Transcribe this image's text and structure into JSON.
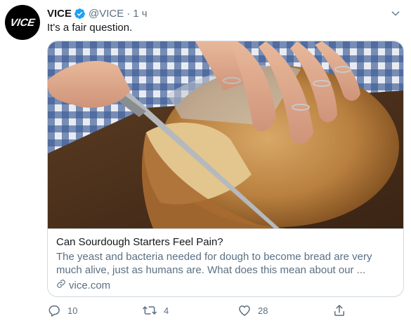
{
  "tweet": {
    "author": {
      "name": "VICE",
      "handle": "@VICE",
      "verified": true,
      "avatar_text": "VICE"
    },
    "separator": "·",
    "time": "1 ч",
    "text": "It's a fair question."
  },
  "card": {
    "image_icon": "sourdough-bread-photo",
    "title": "Can Sourdough Starters Feel Pain?",
    "description": "The yeast and bacteria needed for dough to become bread are very much alive, just as humans are. What does this mean about our ...",
    "domain": "vice.com"
  },
  "actions": {
    "reply_count": "10",
    "retweet_count": "4",
    "like_count": "28"
  },
  "colors": {
    "accent": "#1da1f2",
    "secondary_text": "#5b7083",
    "border": "#cfd9de"
  }
}
